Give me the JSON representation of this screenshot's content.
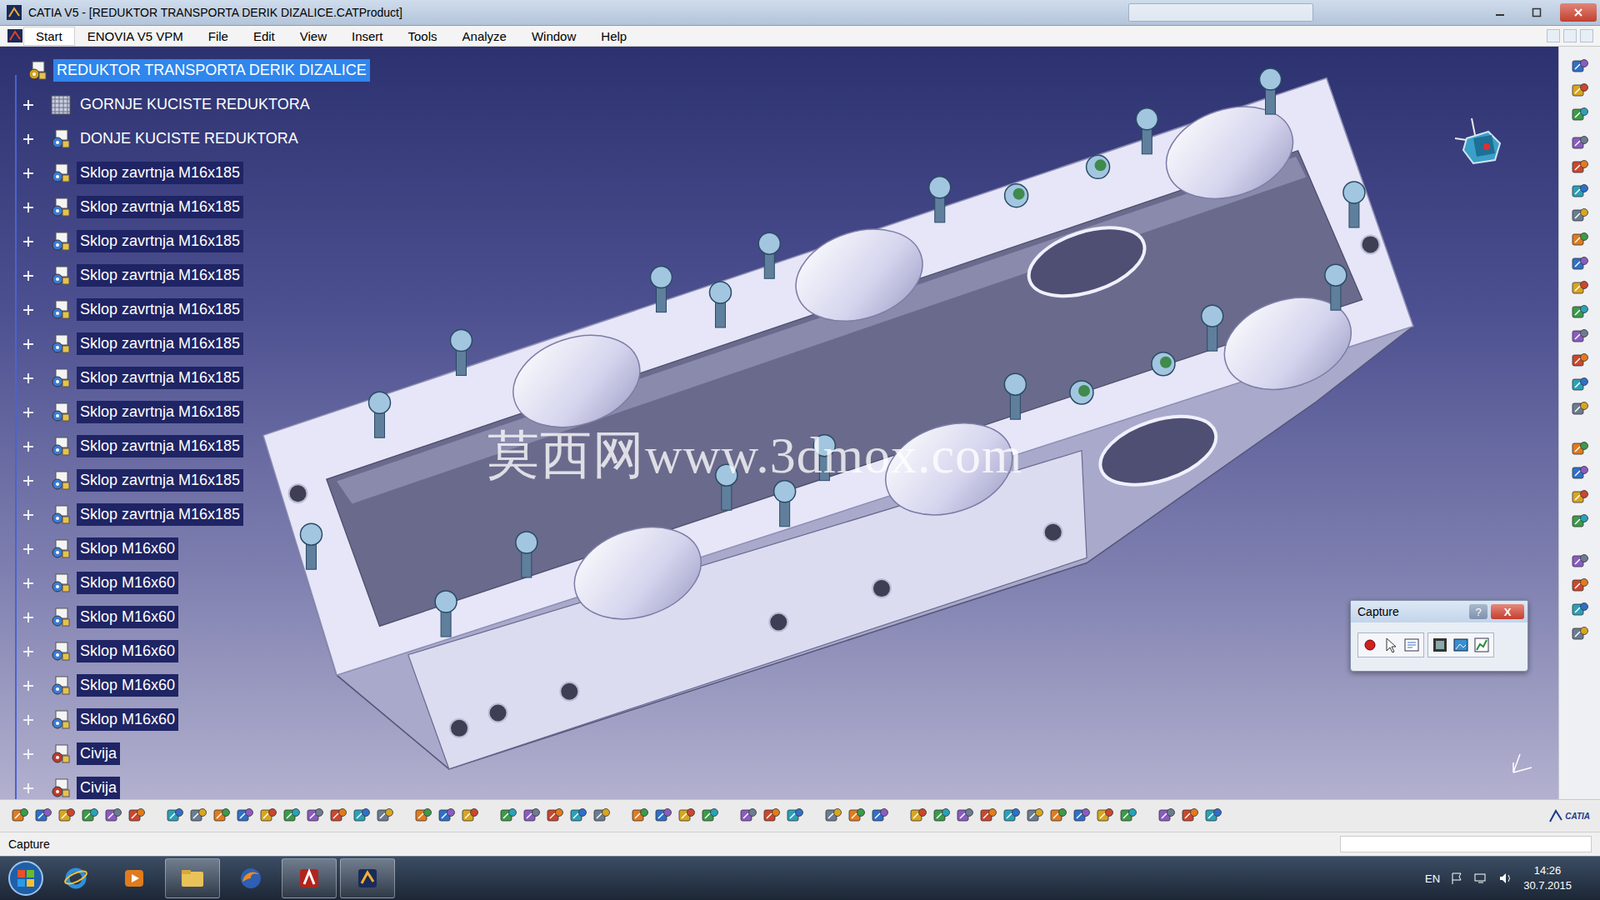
{
  "window": {
    "title": "CATIA V5 - [REDUKTOR TRANSPORTA DERIK DIZALICE.CATProduct]"
  },
  "menu": [
    {
      "label": "Start",
      "selected": true
    },
    {
      "label": "ENOVIA V5 VPM",
      "selected": false
    },
    {
      "label": "File",
      "selected": false
    },
    {
      "label": "Edit",
      "selected": false
    },
    {
      "label": "View",
      "selected": false
    },
    {
      "label": "Insert",
      "selected": false
    },
    {
      "label": "Tools",
      "selected": false
    },
    {
      "label": "Analyze",
      "selected": false
    },
    {
      "label": "Window",
      "selected": false
    },
    {
      "label": "Help",
      "selected": false
    }
  ],
  "tree": [
    {
      "label": "REDUKTOR TRANSPORTA DERIK DIZALICE",
      "kind": "root",
      "selected": true,
      "highlighted": false,
      "expanded": true
    },
    {
      "label": "GORNJE KUCISTE REDUKTORA",
      "kind": "part",
      "selected": false,
      "highlighted": false,
      "expanded": false
    },
    {
      "label": "DONJE KUCISTE REDUKTORA",
      "kind": "product",
      "selected": false,
      "highlighted": false,
      "expanded": false
    },
    {
      "label": "Sklop zavrtnja M16x185",
      "kind": "product",
      "selected": false,
      "highlighted": true,
      "expanded": false
    },
    {
      "label": "Sklop zavrtnja M16x185",
      "kind": "product",
      "selected": false,
      "highlighted": true,
      "expanded": false
    },
    {
      "label": "Sklop zavrtnja M16x185",
      "kind": "product",
      "selected": false,
      "highlighted": true,
      "expanded": false
    },
    {
      "label": "Sklop zavrtnja M16x185",
      "kind": "product",
      "selected": false,
      "highlighted": true,
      "expanded": false
    },
    {
      "label": "Sklop zavrtnja M16x185",
      "kind": "product",
      "selected": false,
      "highlighted": true,
      "expanded": false
    },
    {
      "label": "Sklop zavrtnja M16x185",
      "kind": "product",
      "selected": false,
      "highlighted": true,
      "expanded": false
    },
    {
      "label": "Sklop zavrtnja M16x185",
      "kind": "product",
      "selected": false,
      "highlighted": true,
      "expanded": false
    },
    {
      "label": "Sklop zavrtnja M16x185",
      "kind": "product",
      "selected": false,
      "highlighted": true,
      "expanded": false
    },
    {
      "label": "Sklop zavrtnja M16x185",
      "kind": "product",
      "selected": false,
      "highlighted": true,
      "expanded": false
    },
    {
      "label": "Sklop zavrtnja M16x185",
      "kind": "product",
      "selected": false,
      "highlighted": true,
      "expanded": false
    },
    {
      "label": "Sklop zavrtnja M16x185",
      "kind": "product",
      "selected": false,
      "highlighted": true,
      "expanded": false
    },
    {
      "label": "Sklop M16x60",
      "kind": "product",
      "selected": false,
      "highlighted": true,
      "expanded": false
    },
    {
      "label": "Sklop M16x60",
      "kind": "product",
      "selected": false,
      "highlighted": true,
      "expanded": false
    },
    {
      "label": "Sklop M16x60",
      "kind": "product",
      "selected": false,
      "highlighted": true,
      "expanded": false
    },
    {
      "label": "Sklop M16x60",
      "kind": "product",
      "selected": false,
      "highlighted": true,
      "expanded": false
    },
    {
      "label": "Sklop M16x60",
      "kind": "product",
      "selected": false,
      "highlighted": true,
      "expanded": false
    },
    {
      "label": "Sklop M16x60",
      "kind": "product",
      "selected": false,
      "highlighted": true,
      "expanded": false
    },
    {
      "label": "Civija",
      "kind": "pin",
      "selected": false,
      "highlighted": true,
      "expanded": false
    },
    {
      "label": "Civija",
      "kind": "pin",
      "selected": false,
      "highlighted": true,
      "expanded": false
    }
  ],
  "watermark": "莫西网www.3dmox.com",
  "capture_dialog": {
    "title": "Capture",
    "help": "?",
    "close": "X"
  },
  "brand": "CATIA",
  "status_bar": {
    "text": "Capture"
  },
  "taskbar": {
    "language": "EN",
    "time": "14:26",
    "date": "30.7.2015",
    "apps": [
      {
        "kind": "ie",
        "open": false
      },
      {
        "kind": "media",
        "open": false
      },
      {
        "kind": "explorer",
        "open": true
      },
      {
        "kind": "firefox",
        "open": false
      },
      {
        "kind": "autocad",
        "open": true
      },
      {
        "kind": "catia",
        "open": true
      }
    ]
  }
}
